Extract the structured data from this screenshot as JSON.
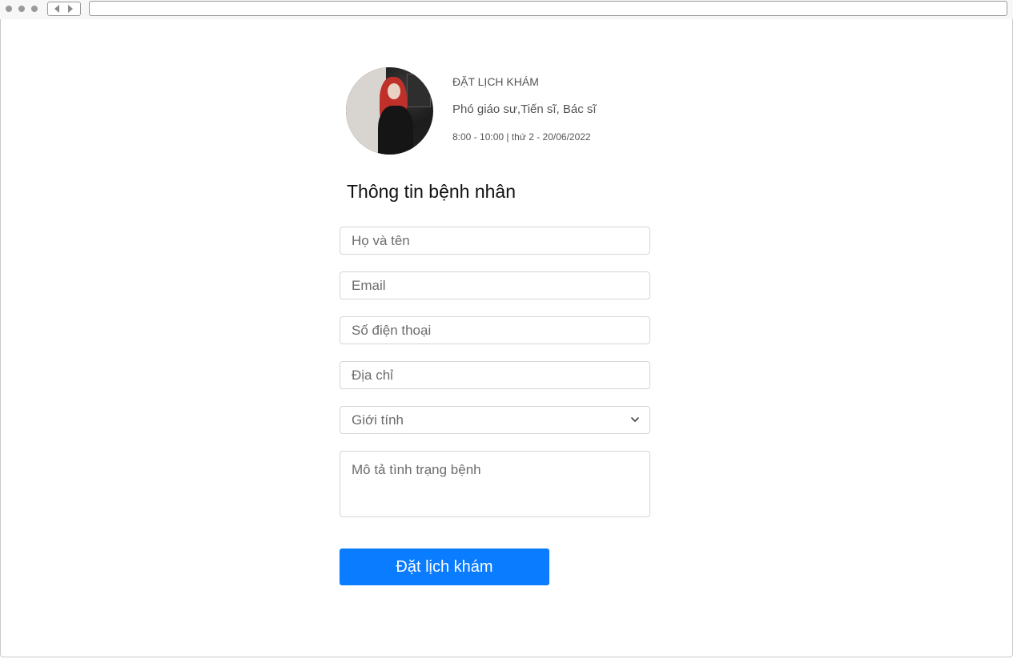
{
  "doctor": {
    "booking_title": "ĐẶT LỊCH KHÁM",
    "title_line": "Phó giáo sư,Tiến sĩ, Bác sĩ",
    "schedule": "8:00 - 10:00 | thứ 2 - 20/06/2022"
  },
  "form": {
    "section_title": "Thông tin bệnh nhân",
    "full_name_placeholder": "Họ và tên",
    "email_placeholder": "Email",
    "phone_placeholder": "Số điện thoại",
    "address_placeholder": "Địa chỉ",
    "gender_selected": "Giới tính",
    "description_placeholder": "Mô tả tình trạng bệnh",
    "submit_label": "Đặt lịch khám"
  },
  "colors": {
    "primary_button": "#0a7cff"
  }
}
